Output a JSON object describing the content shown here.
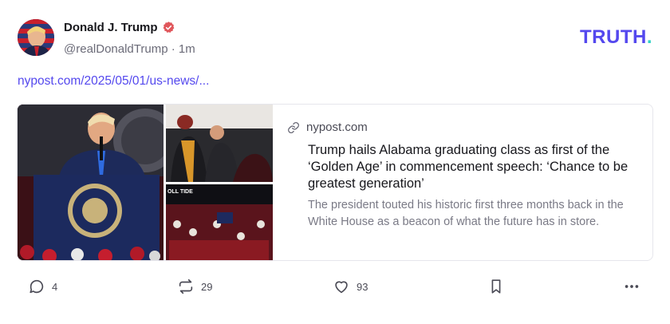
{
  "author": {
    "name": "Donald J. Trump",
    "handle": "@realDonaldTrump",
    "separator": "·",
    "time": "1m"
  },
  "logo": {
    "text": "TRUTH",
    "dot": "."
  },
  "post": {
    "link_text": "nypost.com/2025/05/01/us-news/..."
  },
  "card": {
    "domain": "nypost.com",
    "title": "Trump hails Alabama graduating class as first of the ‘Golden Age’ in commencement speech: ‘Chance to be greatest generation’",
    "description": "The president touted his historic first three months back in the White House as a beacon of what the future has in store.",
    "image_caption": "OLL TIDE"
  },
  "actions": {
    "replies": "4",
    "retruths": "29",
    "likes": "93"
  },
  "colors": {
    "brand": "#5448ee",
    "brand_dot": "#31d3c6",
    "verified": "#e0565b",
    "text_muted": "#6b6b78"
  },
  "icons": [
    "verified-badge-icon",
    "link-icon",
    "reply-icon",
    "retruth-icon",
    "heart-icon",
    "bookmark-icon",
    "more-icon"
  ]
}
